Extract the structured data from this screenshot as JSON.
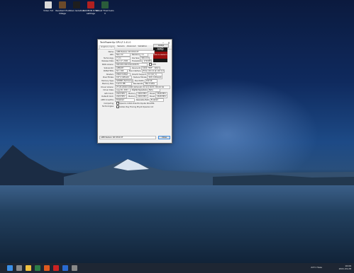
{
  "desktop": {
    "icons": [
      {
        "label": "Video Tut",
        "color": "#d9d9d9"
      },
      {
        "label": "Resident Evil Village",
        "color": "#6b4a2a"
      },
      {
        "label": "Alien Isolation",
        "color": "#1e1e1e"
      },
      {
        "label": "RADEON 6700 settings",
        "color": "#b02020"
      },
      {
        "label": "Ghost Thief Auto V",
        "color": "#2a5c3a"
      }
    ]
  },
  "window": {
    "title": "TechPowerUp GPU-Z 2.41.0",
    "tabs": [
      "Graphics Card",
      "Sensors",
      "Advanced",
      "Validation"
    ],
    "lookup_label": "Lookup",
    "brand": "AMD",
    "brand_sub": "RADEON GRAPHICS",
    "uefi_label": "UEFI",
    "rows": [
      {
        "label": "Name",
        "value": "AMD Radeon RX 6700 XT",
        "sublabel": "",
        "value2": ""
      },
      {
        "label": "GPU",
        "value": "Navi 22",
        "sublabel": "Revision",
        "value2": "C1"
      },
      {
        "label": "Technology",
        "value": "7 nm",
        "sublabel": "Die Size",
        "value2": "336 mm²"
      },
      {
        "label": "Release Date",
        "value": "Mar 17, 2021",
        "sublabel": "Transistors",
        "value2": "17200M"
      },
      {
        "label": "BIOS Version",
        "value": "020.001.000.019.018475",
        "sublabel": "",
        "value2": ""
      },
      {
        "label": "Subvendor",
        "value": "AMD/ATI",
        "sublabel": "Device ID",
        "value2": "1002 73DF - 1002 0E36"
      },
      {
        "label": "ROPs/TMUs",
        "value": "64 / 160",
        "sublabel": "Bus Interface",
        "value2": "PCIe x16 4.0 @ x16 4.0"
      },
      {
        "label": "Shaders",
        "value": "2560 Unified",
        "sublabel": "DirectX Support",
        "value2": "12 (12_1)"
      },
      {
        "label": "Pixel Fillrate",
        "value": "167.4 GPixel/s",
        "sublabel": "Texture Fillrate",
        "value2": "418.4 GTexel/s"
      },
      {
        "label": "Memory Type",
        "value": "GDDR6 (Samsung)",
        "sublabel": "Bus Width",
        "value2": "192 bit"
      },
      {
        "label": "Memory Size",
        "value": "12272 MB",
        "sublabel": "Bandwidth",
        "value2": "384.0 GB/s"
      },
      {
        "label": "Driver Version",
        "value": "27.20.22022.1006 (Adrenalin 21.9.1) DCH / Win10 64",
        "sublabel": "",
        "value2": ""
      },
      {
        "label": "Driver Date",
        "value": "Aug 26, 2021",
        "sublabel": "Digital Signature",
        "value2": "Beta"
      },
      {
        "label": "GPU Clock",
        "value": "2424 MHz",
        "sublabel": "Memory",
        "value2": "2000 MHz"
      },
      {
        "label": "Default Clock",
        "value": "2424 MHz",
        "sublabel": "Memory",
        "value2": "2000 MHz"
      },
      {
        "label": "AMD CrossFire",
        "value": "Disabled",
        "sublabel": "Resizable BAR",
        "value2": "Enabled"
      },
      {
        "label": "Computing",
        "value": "OpenCL  CUDA  DirectCompute  DirectML",
        "sublabel": "",
        "value2": ""
      },
      {
        "label": "Technologies",
        "value": "Vulkan  Ray Tracing  PhysX  OpenGL 4.6",
        "sublabel": "",
        "value2": ""
      }
    ],
    "boost_label": "Boost",
    "boost_values": [
      "2618 MHz",
      "2618 MHz"
    ],
    "footer_select": "AMD Radeon RX 6700 XT",
    "close_label": "Close"
  },
  "taskbar": {
    "weather": "24°C  Haze",
    "time": "16:09",
    "date": "2021-09-28",
    "icon_colors": [
      "#3a8ee6",
      "#8a8a8a",
      "#f0c040",
      "#2d7d46",
      "#e05a20",
      "#cc2222",
      "#2a6ad0",
      "#888888"
    ]
  }
}
